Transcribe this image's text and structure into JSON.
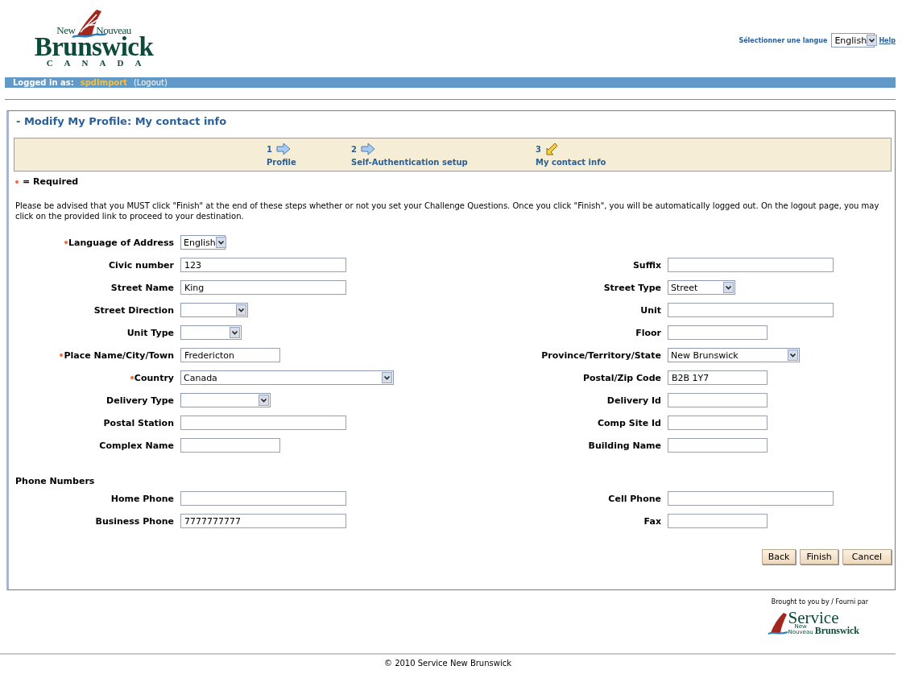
{
  "logo": {
    "word_left": "New",
    "word_right": "Nouveau",
    "main": "Brunswick",
    "country": "CANADA"
  },
  "header": {
    "language_label": "Sélectionner une langue",
    "language_value": "English",
    "help": "Help"
  },
  "user_bar": {
    "label": "Logged in as:",
    "user": "spdImport",
    "logout": "(Logout)"
  },
  "title": "- Modify My Profile: My contact info",
  "steps": [
    {
      "number": "1",
      "label": "Profile",
      "selected": false
    },
    {
      "number": "2",
      "label": "Self-Authentication setup",
      "selected": false
    },
    {
      "number": "3",
      "label": "My contact info",
      "selected": true
    }
  ],
  "required_note": "= Required",
  "notice": "Please be advised that you MUST click \"Finish\" at the end of these steps whether or not you set your Challenge Questions. Once you click \"Finish\", you will be automatically logged out. On the logout page, you may click on the provided link to proceed to your destination.",
  "address_rows": [
    {
      "left": {
        "label": "Language of Address",
        "required": true,
        "kind": "select",
        "value": "English"
      }
    },
    {
      "left": {
        "label": "Civic number",
        "required": false,
        "kind": "text",
        "value": "123"
      },
      "right": {
        "label": "Suffix",
        "required": false,
        "kind": "text"
      }
    },
    {
      "left": {
        "label": "Street Name",
        "required": false,
        "kind": "text",
        "value": "King"
      },
      "right": {
        "label": "Street Type",
        "required": false,
        "kind": "select",
        "value": "Street"
      }
    },
    {
      "left": {
        "label": "Street Direction",
        "required": false,
        "kind": "select"
      },
      "right": {
        "label": "Unit",
        "required": false,
        "kind": "text"
      }
    },
    {
      "left": {
        "label": "Unit Type",
        "required": false,
        "kind": "select"
      },
      "right": {
        "label": "Floor",
        "required": false,
        "kind": "text"
      }
    },
    {
      "left": {
        "label": "Place Name/City/Town",
        "required": true,
        "kind": "text",
        "value": "Fredericton"
      },
      "right": {
        "label": "Province/Territory/State",
        "required": false,
        "kind": "select",
        "value": "New Brunswick"
      }
    },
    {
      "left": {
        "label": "Country",
        "required": true,
        "kind": "select",
        "value": "Canada"
      },
      "right": {
        "label": "Postal/Zip Code",
        "required": false,
        "kind": "text",
        "value": "B2B 1Y7"
      }
    },
    {
      "left": {
        "label": "Delivery Type",
        "required": false,
        "kind": "select"
      },
      "right": {
        "label": "Delivery Id",
        "required": false,
        "kind": "text"
      }
    },
    {
      "left": {
        "label": "Postal Station",
        "required": false,
        "kind": "text"
      },
      "right": {
        "label": "Comp Site Id",
        "required": false,
        "kind": "text"
      }
    },
    {
      "left": {
        "label": "Complex Name",
        "required": false,
        "kind": "text"
      },
      "right": {
        "label": "Building Name",
        "required": false,
        "kind": "text"
      }
    }
  ],
  "phone_heading": "Phone Numbers",
  "phone_rows": [
    {
      "left": {
        "label": "Home Phone",
        "required": false,
        "kind": "text"
      },
      "right": {
        "label": "Cell Phone",
        "required": false,
        "kind": "text"
      }
    },
    {
      "left": {
        "label": "Business Phone",
        "required": false,
        "kind": "text",
        "value": "7777777777"
      },
      "right": {
        "label": "Fax",
        "required": false,
        "kind": "text"
      }
    }
  ],
  "buttons": [
    "Back",
    "Finish",
    "Cancel"
  ],
  "footer": {
    "credit": "Brought to you by / Fourni par",
    "service_logo": {
      "main": "Service",
      "small_top": "New",
      "small_bottom": "Nouveau",
      "sub": "Brunswick"
    },
    "copyright": "© 2010 Service New Brunswick"
  }
}
